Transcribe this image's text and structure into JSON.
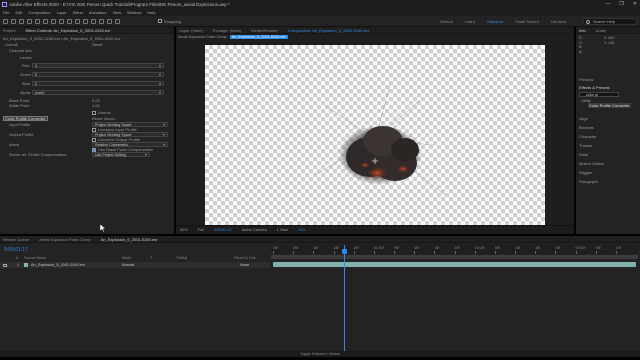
{
  "window": {
    "title": "Adobe After Effects 2020 - E:\\YS\\ 2DE Pesom Quick Tutorial\\Program Files\\DE Pesom_aerial Explosions.aep *",
    "controls": [
      "—",
      "❐",
      "✕"
    ]
  },
  "menu": [
    "File",
    "Edit",
    "Composition",
    "Layer",
    "Effect",
    "Animation",
    "View",
    "Window",
    "Help"
  ],
  "toolbar": {
    "snapping_label": "Snapping",
    "workspaces": [
      "Default",
      "Learn",
      "Standard",
      "Small Screen",
      "Libraries"
    ],
    "active_workspace": "Standard",
    "search_placeholder": "Search Help"
  },
  "left_panel": {
    "tabs": [
      "Project",
      "Effect Controls: An_Explosion_5_2001-0240.exr"
    ],
    "breadcrumb": "An_Explosion_5_2001-0240.exr • An_Explosion_5_2001-0240.exr",
    "effect_name": "Unmult",
    "effect_reset": "Reset",
    "channel_info_label": "Channel Info",
    "levels": {
      "label": "Levels",
      "rows": [
        {
          "label": "Red",
          "value": "0"
        },
        {
          "label": "Green",
          "value": "0"
        },
        {
          "label": "Blue",
          "value": "0"
        },
        {
          "label": "Alpha",
          "value": "(user)"
        }
      ]
    },
    "points": [
      {
        "label": "Black Point",
        "value": "0.00"
      },
      {
        "label": "White Point",
        "value": "1.00"
      }
    ],
    "unmult_checkbox": "Unmult",
    "color_profile": {
      "name": "Color Profile Converter",
      "reset": "Reset",
      "about": "About..."
    },
    "input_profile": {
      "label": "Input Profile",
      "value": "Project Working Space"
    },
    "linearize_input": "Linearize Input Profile",
    "output_profile": {
      "label": "Output Profile",
      "value": "Project Working Space"
    },
    "linearize_output": "Linearize Output Profile",
    "intent": {
      "label": "Intent",
      "value": "Relative Colorimetric"
    },
    "black_comp": "Use Black Point Compensation",
    "scene_ref": {
      "label": "Scene ref. Profile Compensation",
      "value": "Use Project Setting"
    }
  },
  "viewer": {
    "tabs": [
      "Layer: (none)",
      "Footage: (none)",
      "Media Browser",
      "Composition: An_Explosion_5_2001-0240.exr"
    ],
    "breadcrumb": [
      "Aerial Explosion Flash Comp",
      "An_Explosion_5_2001-0240.exr"
    ],
    "bottom_bar": [
      "50%",
      "Full",
      "0:00:01:17",
      "Active Camera",
      "1 View",
      "+0.0"
    ]
  },
  "right_panel": {
    "tabs": [
      "Info",
      "Audio"
    ],
    "info_values": [
      "R:",
      "G:",
      "B:",
      "A:"
    ],
    "coords": [
      "X: 652",
      "Y: 128"
    ],
    "sections": [
      "Preview",
      "Effects & Presets",
      "Align",
      "Brushes",
      "Character",
      "Tracker",
      "Paint",
      "Motion Sketch",
      "Wiggler",
      "Paragraph"
    ],
    "search_value": "color pr",
    "tree": [
      "Utility",
      "Color Profile Converter"
    ]
  },
  "timeline": {
    "tabs": [
      "Render Queue",
      "Aerial Explosion Flash Comp",
      "An_Explosion_5_2001-0240.exr"
    ],
    "time": "0:00:01:17",
    "columns": [
      "#",
      "Source Name",
      "Mode",
      "T",
      "TrkMat",
      "Parent & Link"
    ],
    "layer": {
      "index": "1",
      "name": "An_Explosion_5_2001-0240.exr",
      "mode": "Normal",
      "parent": "None"
    },
    "ruler": [
      "00f",
      "05f",
      "10f",
      "15f",
      "20f",
      "01:00f",
      "05f",
      "10f",
      "15f",
      "20f",
      "02:00f",
      "05f",
      "10f",
      "15f",
      "20f",
      "03:00f",
      "05f",
      "10f"
    ],
    "footer": "Toggle Switches / Modes"
  },
  "colors": {
    "accent": "#2d8ceb",
    "layer_bar": "#84b1ad",
    "panel": "#232323"
  }
}
